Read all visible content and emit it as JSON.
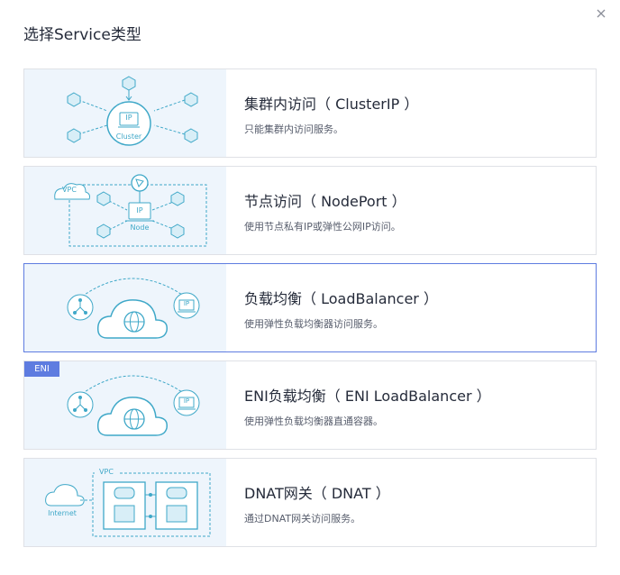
{
  "dialog": {
    "title": "选择Service类型"
  },
  "cards": [
    {
      "title": "集群内访问（ ClusterIP ）",
      "desc": "只能集群内访问服务。",
      "illus": {
        "ip_label": "IP",
        "sub_label": "Cluster"
      }
    },
    {
      "title": "节点访问（ NodePort ）",
      "desc": "使用节点私有IP或弹性公网IP访问。",
      "illus": {
        "vpc_label": "VPC",
        "ip_label": "IP",
        "sub_label": "Node"
      }
    },
    {
      "title": "负载均衡（ LoadBalancer ）",
      "desc": "使用弹性负载均衡器访问服务。",
      "selected": true,
      "illus": {
        "ip_label": "IP"
      }
    },
    {
      "title": "ENI负载均衡（ ENI LoadBalancer ）",
      "desc": "使用弹性负载均衡器直通容器。",
      "badge": "ENI",
      "illus": {
        "ip_label": "IP"
      }
    },
    {
      "title": "DNAT网关（ DNAT ）",
      "desc": "通过DNAT网关访问服务。",
      "illus": {
        "vpc_label": "VPC",
        "internet_label": "Internet"
      }
    }
  ],
  "colors": {
    "accent": "#5e7ce0",
    "icon_teal": "#3fa8c8",
    "illus_bg": "#eef5fc"
  },
  "icons": [
    "close-icon",
    "cluster-icon",
    "node-icon",
    "loadbalancer-icon",
    "dnat-icon"
  ]
}
